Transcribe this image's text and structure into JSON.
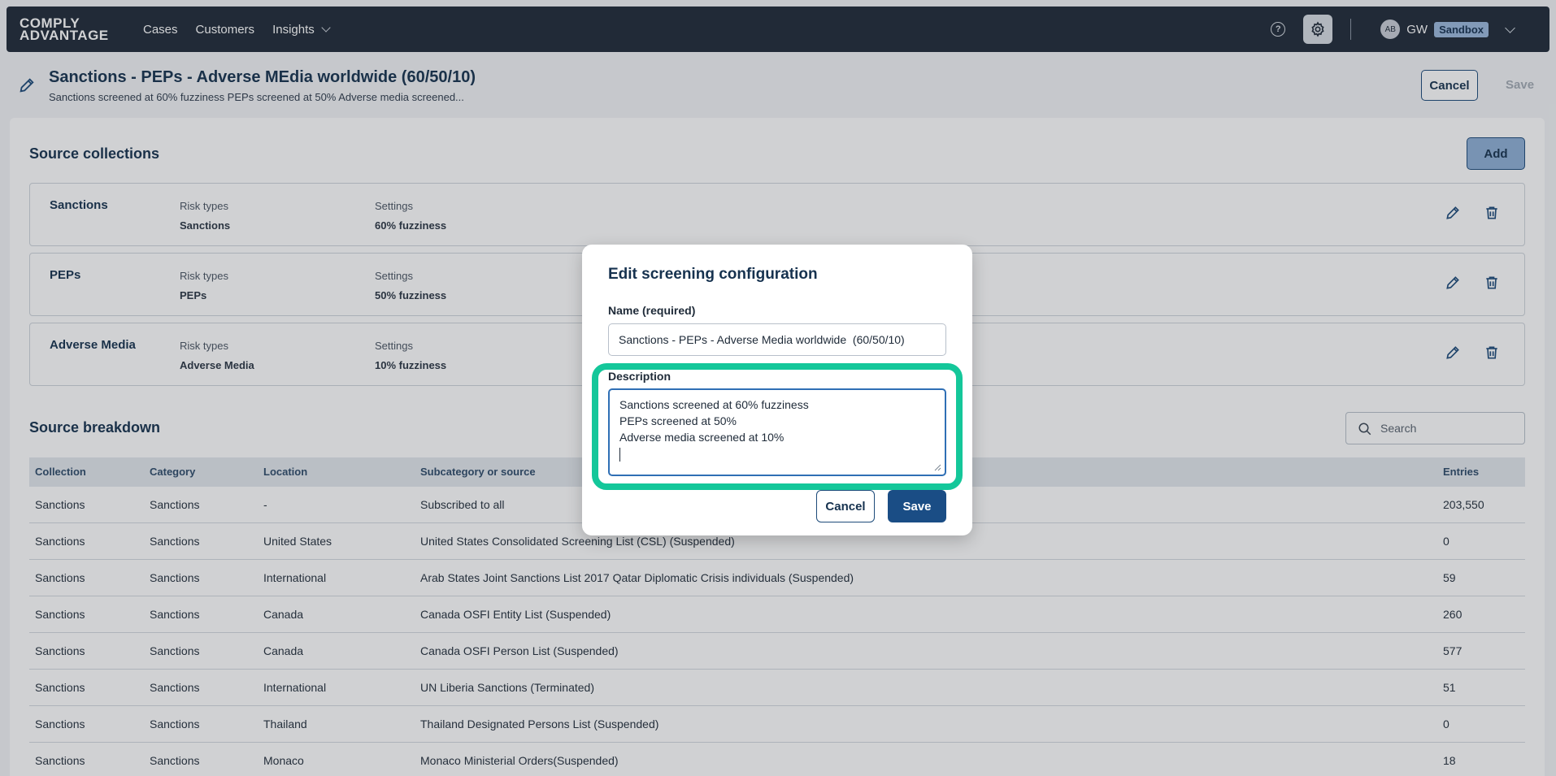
{
  "nav": {
    "logo_line1": "COMPLY",
    "logo_line2": "ADVANTAGE",
    "items": [
      "Cases",
      "Customers",
      "Insights"
    ],
    "avatar_initials": "AB",
    "user_initials": "GW",
    "environment": "Sandbox"
  },
  "header": {
    "title": "Sanctions - PEPs - Adverse MEdia worldwide (60/50/10)",
    "subtitle": "Sanctions screened at 60% fuzziness PEPs screened at 50% Adverse media screened...",
    "cancel_label": "Cancel",
    "save_label": "Save"
  },
  "source_collections": {
    "title": "Source collections",
    "add_label": "Add",
    "risk_types_label": "Risk types",
    "settings_label": "Settings",
    "rows": [
      {
        "name": "Sanctions",
        "risk_type": "Sanctions",
        "setting": "60% fuzziness"
      },
      {
        "name": "PEPs",
        "risk_type": "PEPs",
        "setting": "50% fuzziness"
      },
      {
        "name": "Adverse Media",
        "risk_type": "Adverse Media",
        "setting": "10% fuzziness"
      }
    ]
  },
  "source_breakdown": {
    "title": "Source breakdown",
    "search_placeholder": "Search",
    "columns": [
      "Collection",
      "Category",
      "Location",
      "Subcategory or source",
      "Entries"
    ],
    "rows": [
      [
        "Sanctions",
        "Sanctions",
        "-",
        "Subscribed to all",
        "203,550"
      ],
      [
        "Sanctions",
        "Sanctions",
        "United States",
        "United States Consolidated Screening List (CSL) (Suspended)",
        "0"
      ],
      [
        "Sanctions",
        "Sanctions",
        "International",
        "Arab States Joint Sanctions List 2017 Qatar Diplomatic Crisis individuals (Suspended)",
        "59"
      ],
      [
        "Sanctions",
        "Sanctions",
        "Canada",
        "Canada OSFI Entity List (Suspended)",
        "260"
      ],
      [
        "Sanctions",
        "Sanctions",
        "Canada",
        "Canada OSFI Person List (Suspended)",
        "577"
      ],
      [
        "Sanctions",
        "Sanctions",
        "International",
        "UN Liberia Sanctions (Terminated)",
        "51"
      ],
      [
        "Sanctions",
        "Sanctions",
        "Thailand",
        "Thailand Designated Persons List (Suspended)",
        "0"
      ],
      [
        "Sanctions",
        "Sanctions",
        "Monaco",
        "Monaco Ministerial Orders(Suspended)",
        "18"
      ]
    ]
  },
  "modal": {
    "title": "Edit screening configuration",
    "name_label": "Name (required)",
    "name_value": "Sanctions - PEPs - Adverse Media worldwide  (60/50/10)",
    "description_label": "Description",
    "description_lines": [
      "Sanctions screened at 60% fuzziness",
      "PEPs screened at 50%",
      "Adverse media screened at 10%"
    ],
    "cancel_label": "Cancel",
    "save_label": "Save"
  },
  "colors": {
    "nav_bg": "#1f2a38",
    "primary": "#1a4d85",
    "focus_ring": "#14c79a",
    "title_text": "#16324f"
  }
}
